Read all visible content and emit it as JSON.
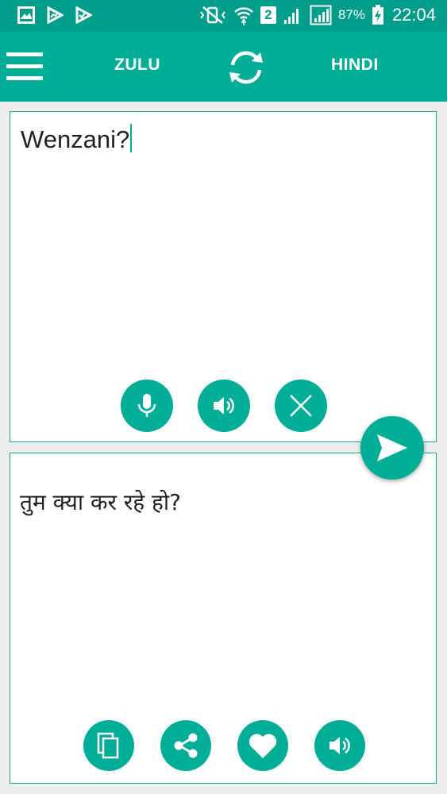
{
  "status_bar": {
    "sim_badge": "2",
    "battery": "87%",
    "time": "22:04"
  },
  "toolbar": {
    "source_language": "ZULU",
    "target_language": "HINDI"
  },
  "input_panel": {
    "text": "Wenzani?"
  },
  "output_panel": {
    "text": "तुम क्या कर रहे हो?"
  },
  "colors": {
    "accent": "#00ad96",
    "status_bar": "#009e8a",
    "background": "#eeeeee"
  },
  "icons": {
    "status_left": [
      "gallery-icon",
      "play-store-icon",
      "download-check-icon"
    ],
    "status_right": [
      "mute-vibrate-icon",
      "wifi-icon",
      "signal-icon",
      "signal-icon",
      "battery-charging-icon"
    ],
    "toolbar": [
      "menu-icon",
      "swap-icon"
    ],
    "input_actions": [
      "microphone-icon",
      "speaker-icon",
      "close-icon"
    ],
    "send": "send-icon",
    "output_actions": [
      "copy-icon",
      "share-icon",
      "heart-icon",
      "speaker-icon"
    ]
  }
}
